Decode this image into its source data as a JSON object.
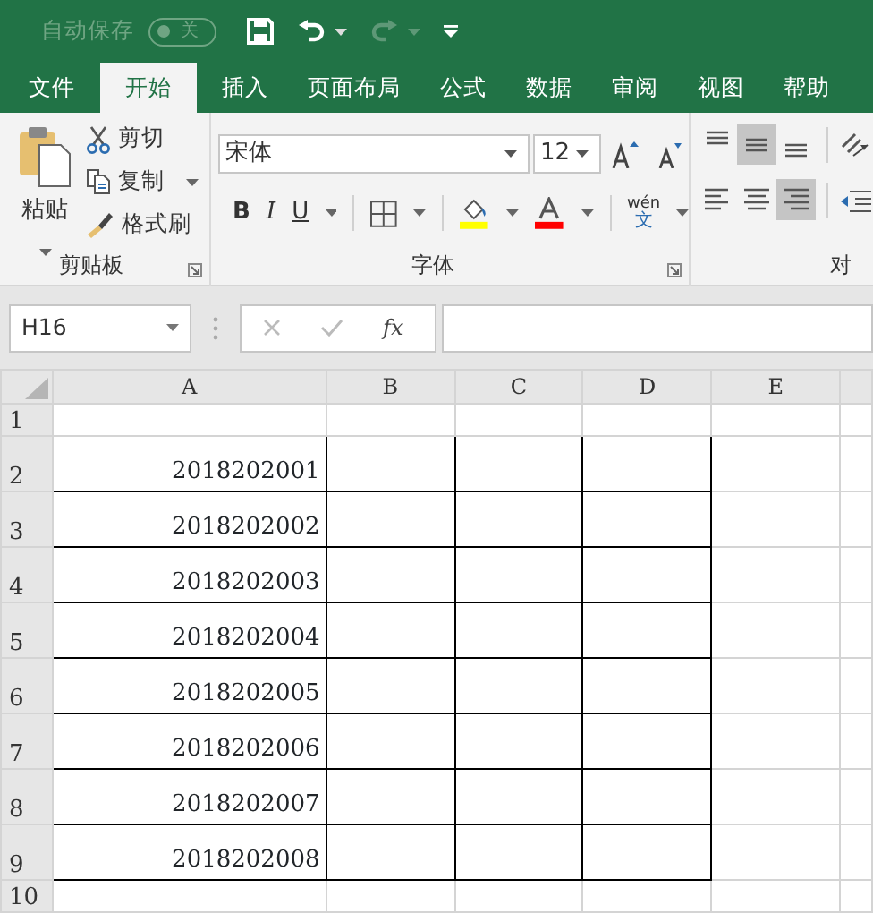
{
  "quick_access": {
    "autosave_label": "自动保存",
    "autosave_toggle": {
      "label": "关",
      "on": false
    },
    "buttons": [
      {
        "kind": "save",
        "disabled": false
      },
      {
        "kind": "undo",
        "disabled": false
      },
      {
        "kind": "redo",
        "disabled": true
      },
      {
        "kind": "customize",
        "disabled": false
      }
    ]
  },
  "tabs": [
    {
      "label": "文件",
      "selected": false
    },
    {
      "label": "开始",
      "selected": true
    },
    {
      "label": "插入",
      "selected": false
    },
    {
      "label": "页面布局",
      "selected": false
    },
    {
      "label": "公式",
      "selected": false
    },
    {
      "label": "数据",
      "selected": false
    },
    {
      "label": "审阅",
      "selected": false
    },
    {
      "label": "视图",
      "selected": false
    },
    {
      "label": "帮助",
      "selected": false
    }
  ],
  "clipboard": {
    "label": "剪贴板",
    "paste_label": "粘贴",
    "items": [
      {
        "kind": "cut",
        "label": "剪切"
      },
      {
        "kind": "copy",
        "label": "复制"
      },
      {
        "kind": "format_painter",
        "label": "格式刷"
      }
    ]
  },
  "font": {
    "label": "字体",
    "font_name": "宋体",
    "font_size": "12",
    "style_buttons": [
      {
        "kind": "bold",
        "label": "B"
      },
      {
        "kind": "italic",
        "label": "I"
      },
      {
        "kind": "underline",
        "label": "U"
      }
    ],
    "phonetic_top": "wén",
    "phonetic_bottom": "文"
  },
  "alignment": {
    "label": "对",
    "vertical": [
      {
        "kind": "top",
        "selected": false
      },
      {
        "kind": "middle",
        "selected": true
      },
      {
        "kind": "bottom",
        "selected": false
      }
    ],
    "horizontal": [
      {
        "kind": "left",
        "selected": false
      },
      {
        "kind": "center",
        "selected": false
      },
      {
        "kind": "right",
        "selected": true
      }
    ]
  },
  "formula_bar": {
    "name_box": "H16",
    "fx": "fx"
  },
  "sheet": {
    "columns": [
      "A",
      "B",
      "C",
      "D",
      "E"
    ],
    "rows": [
      {
        "number": "1",
        "cells": [
          "",
          "",
          "",
          ""
        ],
        "bordered": false
      },
      {
        "number": "2",
        "cells": [
          "2018202001",
          "",
          "",
          ""
        ],
        "bordered": true
      },
      {
        "number": "3",
        "cells": [
          "2018202002",
          "",
          "",
          ""
        ],
        "bordered": true
      },
      {
        "number": "4",
        "cells": [
          "2018202003",
          "",
          "",
          ""
        ],
        "bordered": true
      },
      {
        "number": "5",
        "cells": [
          "2018202004",
          "",
          "",
          ""
        ],
        "bordered": true
      },
      {
        "number": "6",
        "cells": [
          "2018202005",
          "",
          "",
          ""
        ],
        "bordered": true
      },
      {
        "number": "7",
        "cells": [
          "2018202006",
          "",
          "",
          ""
        ],
        "bordered": true
      },
      {
        "number": "8",
        "cells": [
          "2018202007",
          "",
          "",
          ""
        ],
        "bordered": true
      },
      {
        "number": "9",
        "cells": [
          "2018202008",
          "",
          "",
          ""
        ],
        "bordered": true
      },
      {
        "number": "10",
        "cells": [
          "",
          "",
          "",
          ""
        ],
        "bordered": false
      }
    ]
  }
}
